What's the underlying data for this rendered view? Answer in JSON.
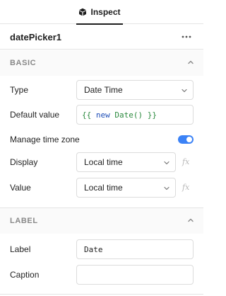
{
  "header": {
    "tab_label": "Inspect",
    "tab_icon": "cube-icon"
  },
  "component": {
    "name": "datePicker1",
    "more_icon": "more-horizontal-icon"
  },
  "sections": {
    "basic": {
      "title": "BASIC",
      "collapsed": false
    },
    "label": {
      "title": "LABEL",
      "collapsed": false
    }
  },
  "basic": {
    "type": {
      "label": "Type",
      "value": "Date Time"
    },
    "default_value": {
      "label": "Default value",
      "code": {
        "open": "{{",
        "keyword": "new",
        "fn": "Date()",
        "close": "}}"
      }
    },
    "manage_tz": {
      "label": "Manage time zone",
      "enabled": true
    },
    "display": {
      "label": "Display",
      "value": "Local time"
    },
    "value": {
      "label": "Value",
      "value": "Local time"
    },
    "fx_label": "fx"
  },
  "label_section": {
    "label": {
      "label": "Label",
      "value": "Date"
    },
    "caption": {
      "label": "Caption",
      "value": ""
    }
  },
  "colors": {
    "accent": "#3b82f6",
    "code_green": "#2b8a3e",
    "code_blue": "#1f4fb8"
  }
}
